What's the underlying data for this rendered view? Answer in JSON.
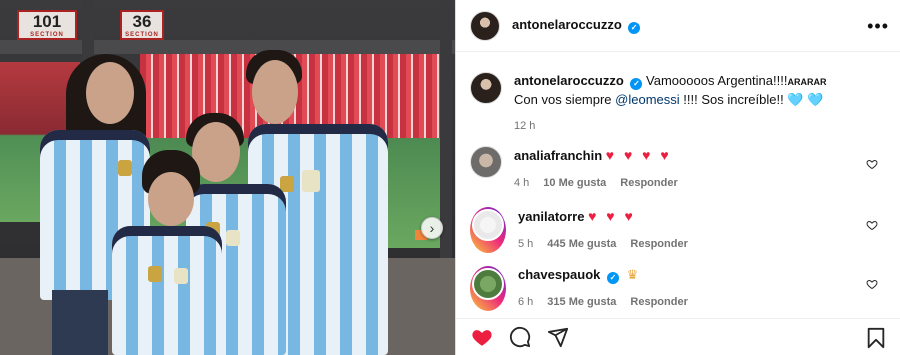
{
  "photo": {
    "section_sign": {
      "number": "101",
      "sub": "SECTION"
    },
    "row_sign": {
      "number": "36",
      "sub": "SECTION"
    }
  },
  "post": {
    "author": "antonelaroccuzzo",
    "more_icon": "more-horizontal-icon",
    "caption": {
      "text_main": "Vamooooos Argentina!!!!",
      "text_tag": "ARARAR",
      "line2_before": "Con vos siempre ",
      "mention": "@leomessi",
      "line2_after": " !!!! Sos increíble!! ",
      "hearts": "🩵 🩵"
    },
    "time": "12 h"
  },
  "comments": [
    {
      "user": "analiafranchin",
      "text": "♥ ♥ ♥ ♥",
      "time": "4 h",
      "likes": "10 Me gusta",
      "reply": "Responder",
      "verified": false
    },
    {
      "user": "yanilatorre",
      "text": "♥ ♥ ♥",
      "time": "5 h",
      "likes": "445 Me gusta",
      "reply": "Responder",
      "verified": false
    },
    {
      "user": "chavespauok",
      "text": "♛",
      "time": "6 h",
      "likes": "315 Me gusta",
      "reply": "Responder",
      "verified": true
    }
  ],
  "colors": {
    "like_red": "#ed1f40",
    "verified_blue": "#0095f6",
    "link_blue": "#00376b",
    "muted": "#737373"
  },
  "actions": {
    "like": "heart-filled-icon",
    "comment": "comment-icon",
    "share": "share-icon",
    "save": "bookmark-icon"
  }
}
